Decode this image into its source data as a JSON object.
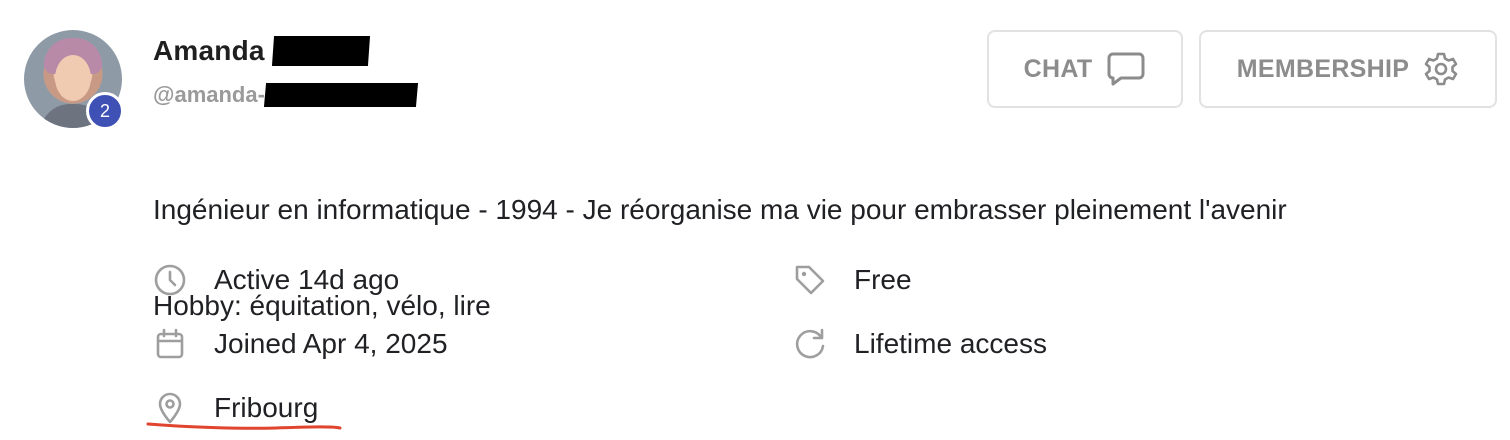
{
  "profile": {
    "name": "Amanda",
    "handle": "@amanda-",
    "notification_count": "2",
    "bio_line1": "Ingénieur en informatique - 1994 - Je réorganise ma vie pour embrasser pleinement l'avenir",
    "bio_line2": "Hobby: équitation, vélo, lire"
  },
  "actions": {
    "chat_label": "CHAT",
    "membership_label": "MEMBERSHIP"
  },
  "details": {
    "activity": "Active 14d ago",
    "joined": "Joined Apr 4, 2025",
    "location": "Fribourg",
    "plan": "Free",
    "access": "Lifetime access"
  },
  "icons": {
    "chat": "chat-bubble-icon",
    "membership": "gear-icon",
    "activity": "clock-icon",
    "joined": "calendar-icon",
    "location": "map-pin-icon",
    "plan": "tag-icon",
    "access": "refresh-icon"
  },
  "colors": {
    "badge": "#3f51b5",
    "button_text": "#8c8c8c",
    "icon": "#9e9e9e",
    "annotation": "#e0442e"
  }
}
